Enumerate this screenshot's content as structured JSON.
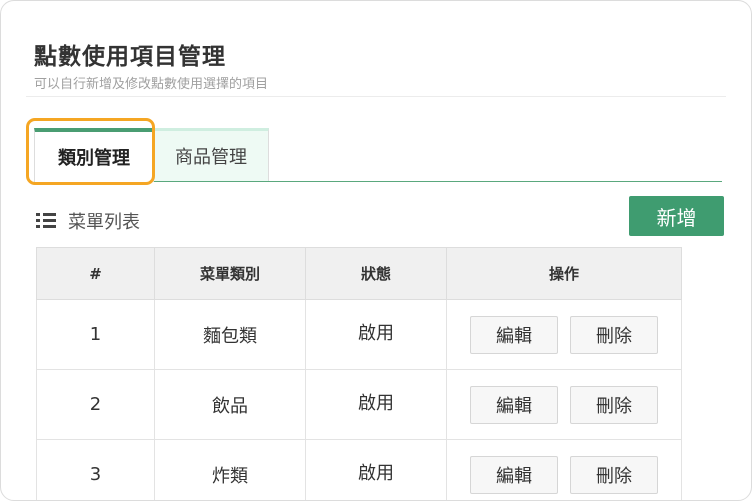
{
  "header": {
    "title": "點數使用項目管理",
    "subtitle": "可以自行新增及修改點數使用選擇的項目"
  },
  "tabs": [
    {
      "label": "類別管理",
      "active": true
    },
    {
      "label": "商品管理",
      "active": false
    }
  ],
  "list": {
    "title": "菜單列表",
    "add_label": "新增"
  },
  "table": {
    "columns": [
      "#",
      "菜單類別",
      "狀態",
      "操作"
    ],
    "rows": [
      {
        "index": "1",
        "category": "麵包類",
        "status": "啟用"
      },
      {
        "index": "2",
        "category": "飲品",
        "status": "啟用"
      },
      {
        "index": "3",
        "category": "炸類",
        "status": "啟用"
      }
    ],
    "edit_label": "編輯",
    "delete_label": "刪除"
  },
  "colors": {
    "accent": "#3f9c70",
    "highlight": "#f5a623"
  }
}
